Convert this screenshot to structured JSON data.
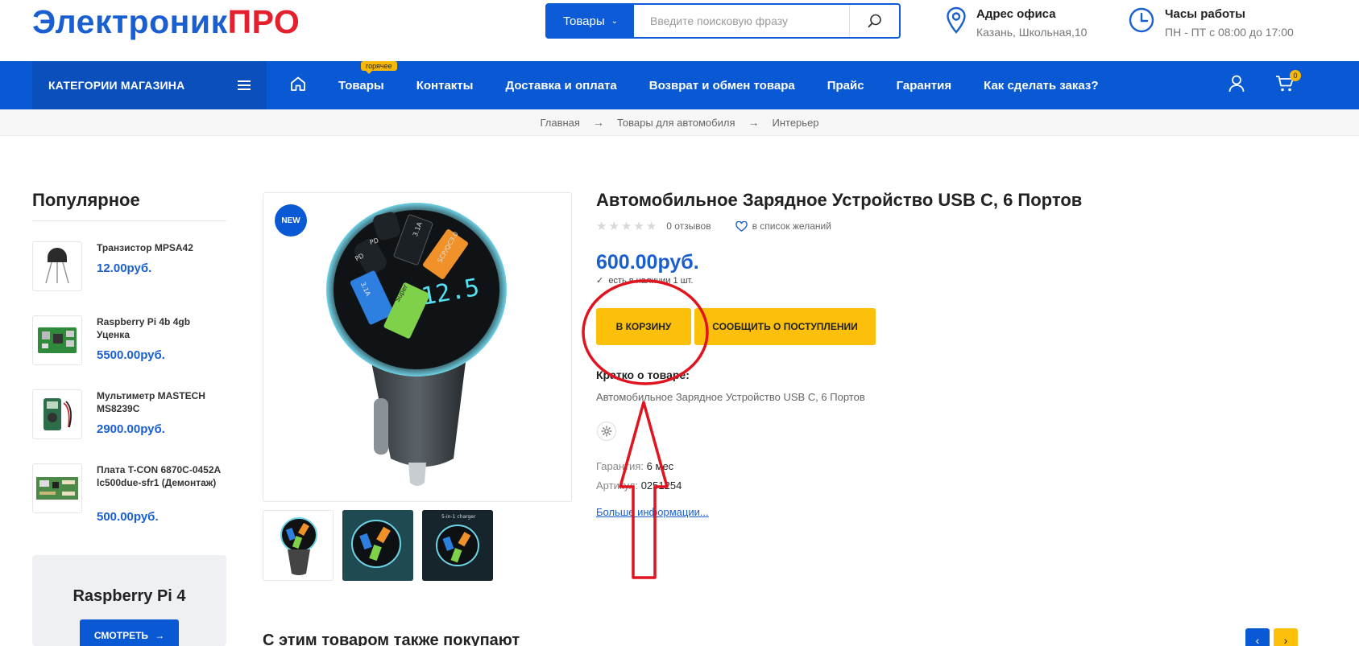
{
  "header": {
    "logo_part1": "Электроник",
    "logo_part2": "ПРО",
    "search": {
      "category_label": "Товары",
      "placeholder": "Введите поисковую фразу"
    },
    "office": {
      "title": "Адрес офиса",
      "value": "Казань, Школьная,10"
    },
    "hours": {
      "title": "Часы работы",
      "value": "ПН - ПТ с 08:00 до 17:00"
    }
  },
  "nav": {
    "categories_label": "КАТЕГОРИИ МАГАЗИНА",
    "items": [
      {
        "label": "Товары",
        "badge": "горячее"
      },
      {
        "label": "Контакты"
      },
      {
        "label": "Доставка и оплата"
      },
      {
        "label": "Возврат и обмен товара"
      },
      {
        "label": "Прайс"
      },
      {
        "label": "Гарантия"
      },
      {
        "label": "Как сделать заказ?"
      }
    ],
    "cart_count": "0"
  },
  "breadcrumb": [
    "Главная",
    "Товары для автомобиля",
    "Интерьер"
  ],
  "sidebar": {
    "title": "Популярное",
    "items": [
      {
        "name": "Транзистор MPSA42",
        "price": "12.00руб."
      },
      {
        "name": "Raspberry Pi 4b 4gb Уценка",
        "price": "5500.00руб."
      },
      {
        "name": "Мультиметр MASTECH MS8239C",
        "price": "2900.00руб."
      },
      {
        "name": "Плата T-CON 6870C-0452A lc500due-sfr1 (Демонтаж)",
        "price": "500.00руб."
      }
    ],
    "promo": {
      "title": "Raspberry Pi 4",
      "button": "СМОТРЕТЬ"
    }
  },
  "product": {
    "badge": "NEW",
    "title": "Автомобильное Зарядное Устройство USB C, 6 Портов",
    "reviews": "0 отзывов",
    "rating": 0,
    "wishlist": "в список желаний",
    "price": "600.00руб.",
    "stock": "есть в наличии 1 шт.",
    "add_to_cart": "В КОРЗИНУ",
    "notify": "СООБЩИТЬ О ПОСТУПЛЕНИИ",
    "brief_heading": "Кратко о товаре:",
    "brief_text": "Автомобильное Зарядное Устройство USB C, 6 Портов",
    "warranty_label": "Гарантия:",
    "warranty_value": "6 мес",
    "sku_label": "Артикул:",
    "sku_value": "0251254",
    "more_link": "Больше информации...",
    "charger_labels": {
      "pd": "PD",
      "port_31a": "3.1A",
      "qc": "SCP/QC3.0",
      "super": "Super",
      "display": "12.5"
    },
    "thumb3_caption": "5-in-1 charger"
  },
  "also_bought": {
    "title": "С этим товаром также покупают"
  },
  "colors": {
    "accent": "#0a59d4",
    "price": "#1a5fd1",
    "button": "#fcc00a",
    "logo_red": "#e3202b",
    "annotation": "#e0141f"
  }
}
